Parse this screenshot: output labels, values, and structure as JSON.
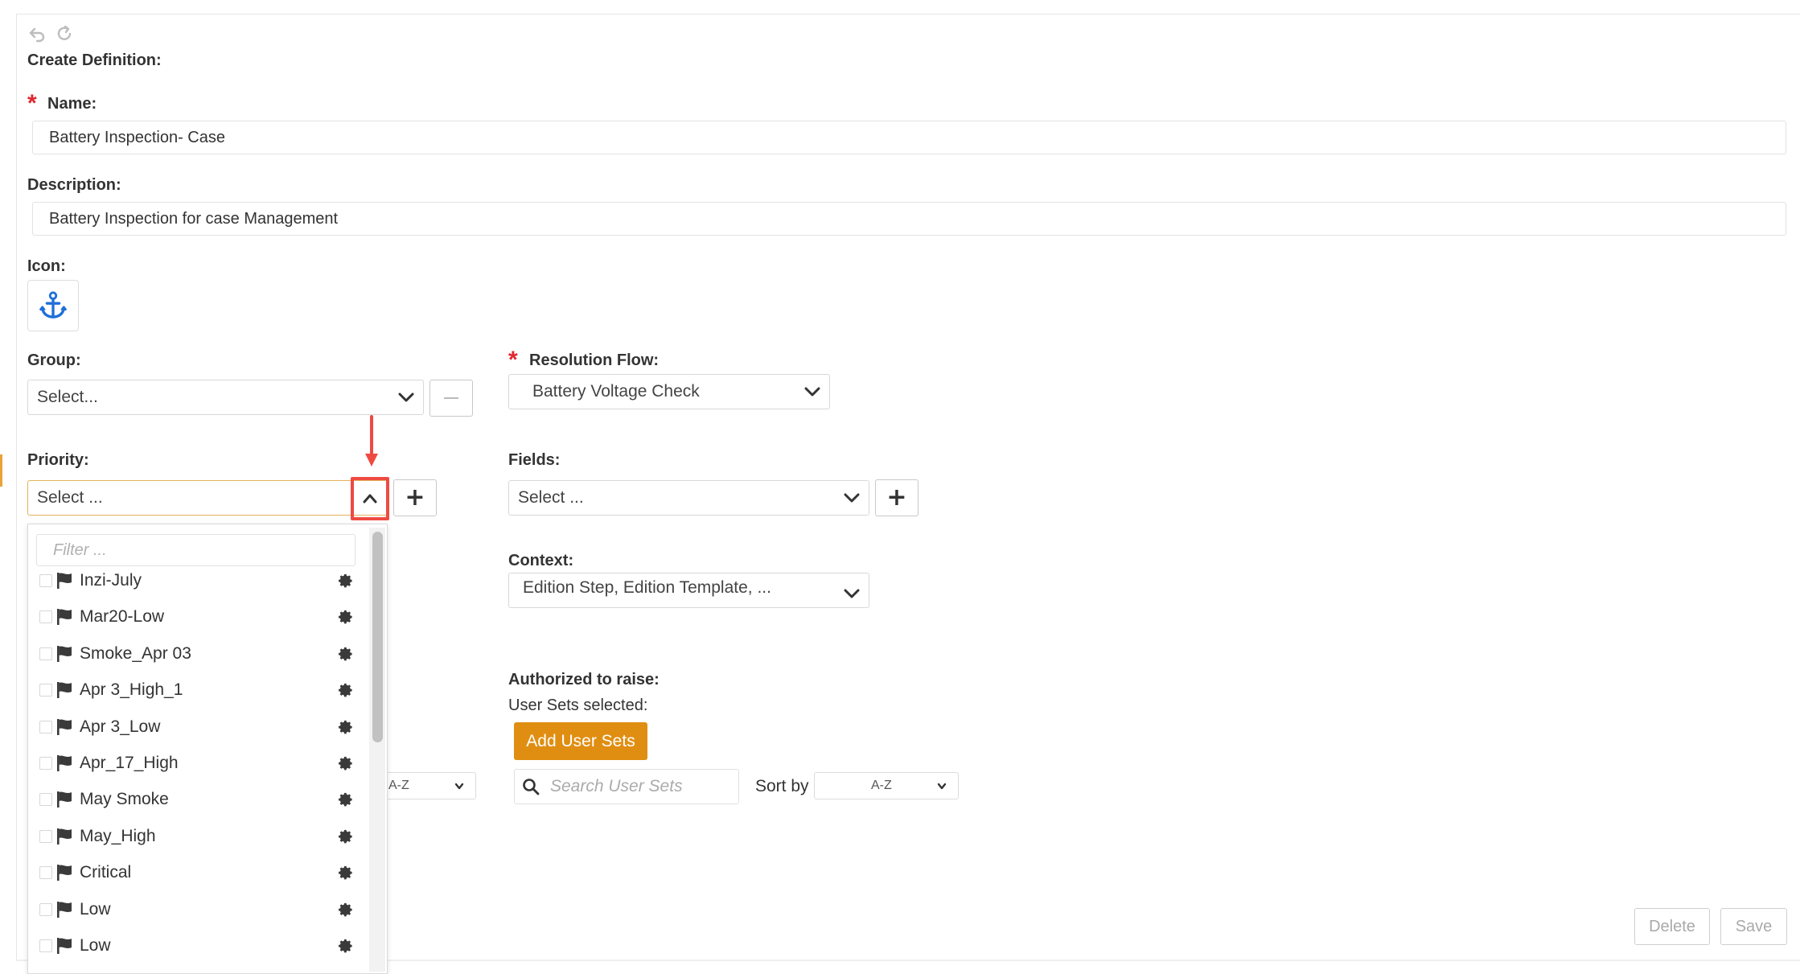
{
  "toolbar": {
    "undo_icon": "undo-icon",
    "redo_icon": "redo-icon"
  },
  "form": {
    "title": "Create Definition:",
    "name": {
      "label": "Name:",
      "value": "Battery Inspection- Case"
    },
    "description": {
      "label": "Description:",
      "value": "Battery Inspection for case Management"
    },
    "icon": {
      "label": "Icon:",
      "glyph": "⚓",
      "color": "#1e6fd9"
    },
    "group": {
      "label": "Group:",
      "value": "Select..."
    },
    "resolution_flow": {
      "label": "Resolution Flow:",
      "value": "Battery Voltage Check"
    },
    "priority": {
      "label": "Priority:",
      "value": "Select ..."
    },
    "fields": {
      "label": "Fields:",
      "value": "Select ..."
    },
    "context": {
      "label": "Context:",
      "value": "Edition Step, Edition Template, ..."
    },
    "authorized": {
      "label": "Authorized to raise:",
      "selected_label": "User Sets selected:",
      "add_button": "Add User Sets",
      "search_placeholder": "Search User Sets",
      "sort_label": "Sort by",
      "sort_value": "A-Z"
    },
    "left_sort_value": "A-Z"
  },
  "priority_dropdown": {
    "filter_placeholder": "Filter ...",
    "items": [
      {
        "label": "Inzi-July"
      },
      {
        "label": "Mar20-Low"
      },
      {
        "label": "Smoke_Apr 03"
      },
      {
        "label": "Apr 3_High_1"
      },
      {
        "label": "Apr 3_Low"
      },
      {
        "label": "Apr_17_High"
      },
      {
        "label": "May Smoke"
      },
      {
        "label": "May_High"
      },
      {
        "label": "Critical"
      },
      {
        "label": "Low"
      },
      {
        "label": "Low"
      }
    ]
  },
  "footer": {
    "delete_label": "Delete",
    "save_label": "Save"
  },
  "colors": {
    "required": "#e0262f",
    "accent_orange": "#e08e12",
    "highlight": "#ef4a42",
    "icon_blue": "#1e6fd9"
  }
}
